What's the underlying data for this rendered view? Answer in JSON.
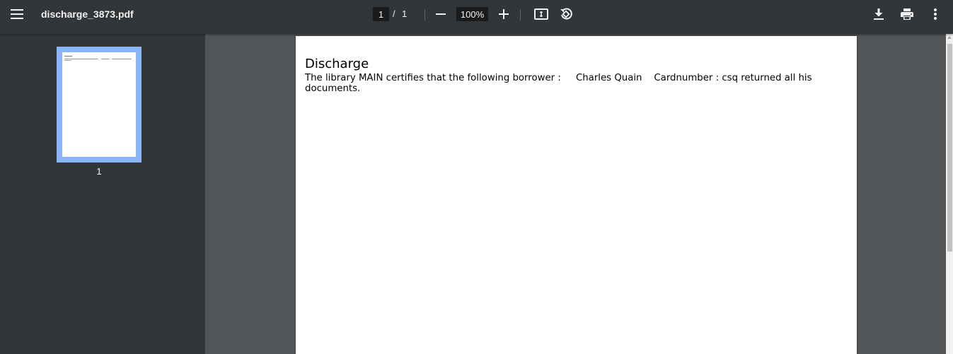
{
  "toolbar": {
    "menu_icon": "menu-icon",
    "file_name": "discharge_3873.pdf",
    "current_page": "1",
    "page_separator": "/",
    "total_pages": "1",
    "zoom_out_icon": "minus-icon",
    "zoom_level": "100%",
    "zoom_in_icon": "plus-icon",
    "fit_page_icon": "fit-to-page-icon",
    "rotate_icon": "rotate-counterclockwise-icon",
    "download_icon": "download-icon",
    "print_icon": "print-icon",
    "more_icon": "more-vertical-icon"
  },
  "sidebar": {
    "thumbnails": [
      {
        "page_number": "1",
        "selected": true
      }
    ]
  },
  "document": {
    "heading": "Discharge",
    "body": "The library MAIN certifies that the following borrower :     Charles Quain    Cardnumber : csq returned all his documents."
  },
  "colors": {
    "toolbar_bg": "#323639",
    "viewer_bg": "#525659",
    "thumbnail_selected": "#8ab4f8",
    "page_bg": "#ffffff"
  }
}
